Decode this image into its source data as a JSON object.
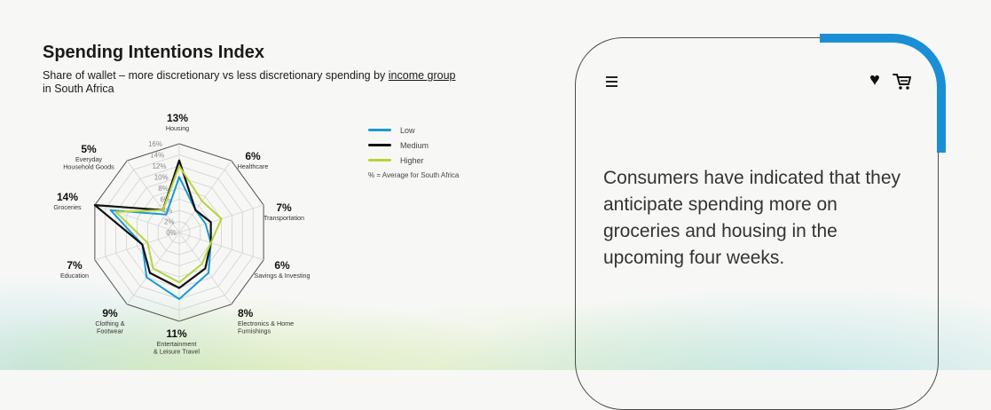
{
  "title": "Spending Intentions Index",
  "subtitle": {
    "part1": "Share of wallet – more discretionary vs less discretionary spending by ",
    "link": "income group",
    "part2": " in South Africa"
  },
  "legend": {
    "items": [
      {
        "label": "Low",
        "color": "#1a9ad6"
      },
      {
        "label": "Medium",
        "color": "#111111"
      },
      {
        "label": "Higher",
        "color": "#b6d33a"
      }
    ],
    "note": "% = Average for South Africa"
  },
  "phone": {
    "text": "Consumers have indicated that they anticipate spending more on groceries and housing in the upcoming four weeks.",
    "accent_color": "#1a8fd6"
  },
  "chart_data": {
    "type": "radar",
    "categories": [
      {
        "pct": "13%",
        "name": [
          "Housing"
        ]
      },
      {
        "pct": "6%",
        "name": [
          "Healthcare"
        ]
      },
      {
        "pct": "7%",
        "name": [
          "Transportation"
        ]
      },
      {
        "pct": "6%",
        "name": [
          "Savings & Investing"
        ]
      },
      {
        "pct": "8%",
        "name": [
          "Electronics & Home",
          "Furnishings"
        ]
      },
      {
        "pct": "11%",
        "name": [
          "Entertainment",
          "& Leisure Travel"
        ]
      },
      {
        "pct": "9%",
        "name": [
          "Clothing &",
          "Footwear"
        ]
      },
      {
        "pct": "7%",
        "name": [
          "Education"
        ]
      },
      {
        "pct": "14%",
        "name": [
          "Groceries"
        ]
      },
      {
        "pct": "5%",
        "name": [
          "Everyday",
          "Household Goods"
        ]
      }
    ],
    "rlim": [
      0,
      16
    ],
    "ticks": [
      "0%",
      "2%",
      "4%",
      "6%",
      "8%",
      "10%",
      "12%",
      "14%",
      "16%"
    ],
    "series": [
      {
        "name": "Low",
        "color": "#1a9ad6",
        "values": [
          10,
          5,
          5,
          6,
          9,
          12,
          10,
          7,
          13,
          4
        ]
      },
      {
        "name": "Medium",
        "color": "#111111",
        "values": [
          13,
          5,
          6,
          6,
          8,
          10,
          9,
          7,
          16,
          5
        ]
      },
      {
        "name": "Higher",
        "color": "#b6d33a",
        "values": [
          12,
          7,
          8,
          6,
          7,
          9,
          8,
          6,
          12,
          5
        ]
      }
    ]
  }
}
